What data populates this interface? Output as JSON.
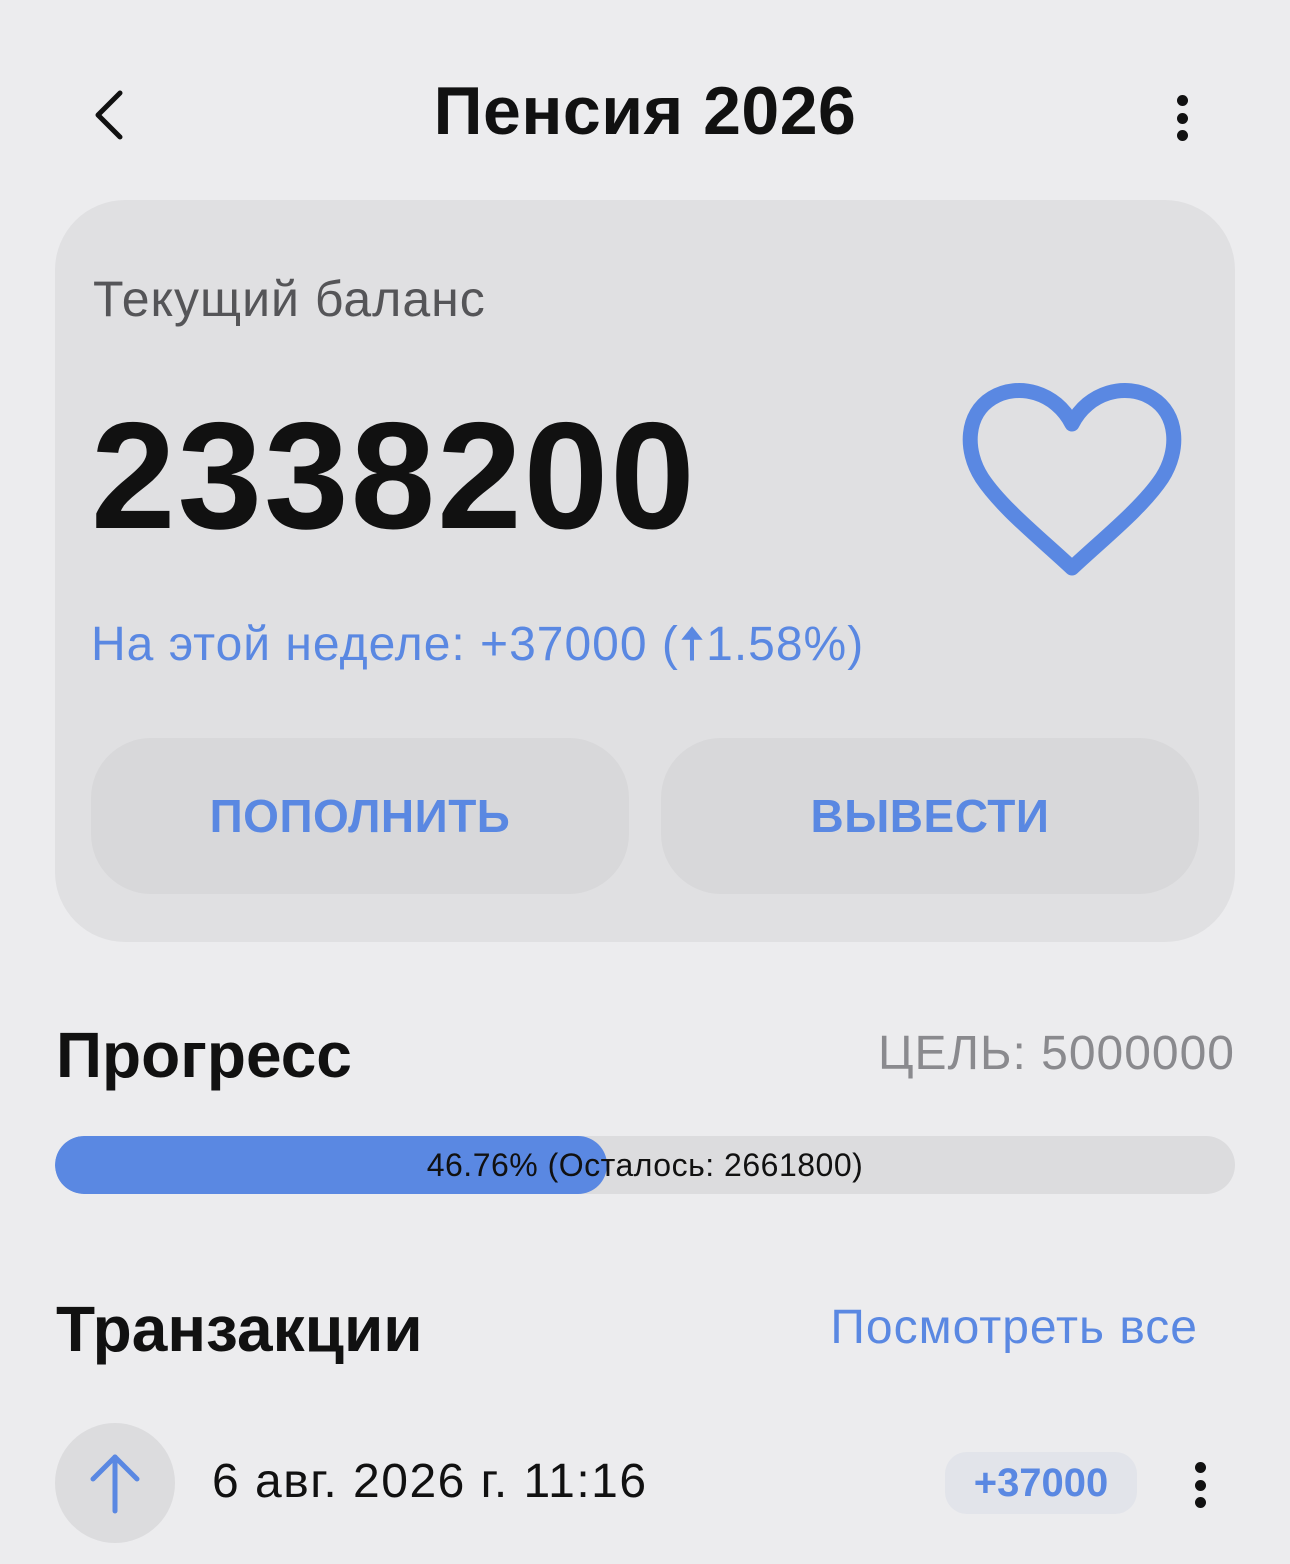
{
  "header": {
    "title": "Пенсия 2026",
    "back_icon": "chevron-left-icon",
    "more_icon": "more-vertical-icon"
  },
  "balance_card": {
    "label": "Текущий баланс",
    "value": "2338200",
    "favorite_icon": "heart-outline-icon",
    "weekly_change": "На этой неделе: +37000 (🠅1.58%)",
    "deposit_label": "ПОПОЛНИТЬ",
    "withdraw_label": "ВЫВЕСТИ"
  },
  "progress": {
    "title": "Прогресс",
    "goal": "ЦЕЛЬ: 5000000",
    "percent": 46.76,
    "text": "46.76% (Осталось: 2661800)"
  },
  "transactions": {
    "title": "Транзакции",
    "view_all_label": "Посмотреть все",
    "items": [
      {
        "icon": "arrow-up-icon",
        "date": "6 авг. 2026 г. 11:16",
        "amount": "+37000"
      }
    ]
  },
  "colors": {
    "background": "#ececee",
    "card": "#e0e0e2",
    "accent": "#5a88e2",
    "text": "#111111",
    "muted": "#8a8a8e"
  }
}
